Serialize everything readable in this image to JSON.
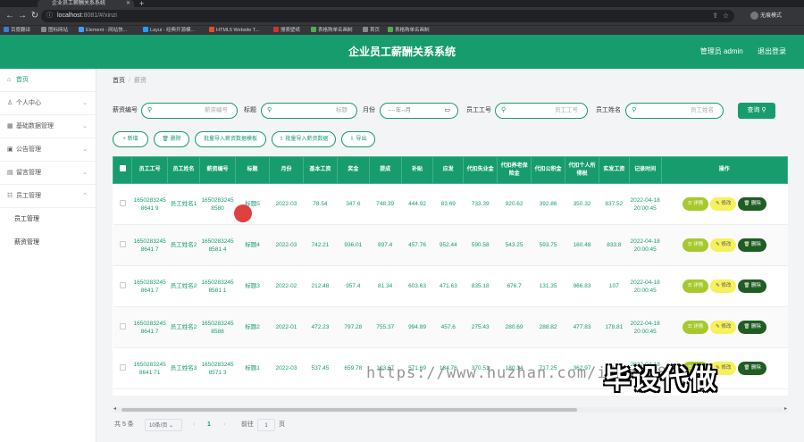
{
  "browser": {
    "tab_title": "企业员工薪酬关系系统",
    "url_host": "localhost",
    "url_rest": ":8081/#/xinzi",
    "profile_label": "无痕模式",
    "bookmarks": [
      "百度翻译",
      "图标网站",
      "Element - 网站快...",
      "Layui - 经典开源模...",
      "HTML5 Website T...",
      "搜索壁纸",
      "表格购单名画制",
      "首页",
      "表格购单名画制"
    ]
  },
  "header": {
    "title": "企业员工薪酬关系系统",
    "admin": "管理员 admin",
    "logout": "退出登录"
  },
  "sidebar": {
    "items": [
      {
        "label": "首页",
        "icon": "home-icon"
      },
      {
        "label": "个人中心",
        "icon": "user-icon"
      },
      {
        "label": "基础数据管理",
        "icon": "grid-icon"
      },
      {
        "label": "公告管理",
        "icon": "notice-icon"
      },
      {
        "label": "留言管理",
        "icon": "message-icon"
      },
      {
        "label": "员工管理",
        "icon": "staff-icon"
      }
    ],
    "subitems": [
      "员工管理",
      "薪资管理"
    ]
  },
  "breadcrumb": {
    "home": "首页",
    "separator": "/",
    "current": "薪资"
  },
  "search": {
    "label1": "薪资编号",
    "placeholder1": "薪资编号",
    "label2": "标题",
    "placeholder2": "标题",
    "label3": "月份",
    "placeholder3": "----年--月",
    "label4": "员工工号",
    "placeholder4": "员工工号",
    "label5": "员工姓名",
    "placeholder5": "员工姓名",
    "query": "查询"
  },
  "actions": {
    "add": "+ 新增",
    "delete": "删除",
    "batch_import": "批量导入薪资数据模板",
    "batch_import2": "批量导入薪资数据",
    "export": "导出"
  },
  "table": {
    "headers": [
      "员工工号",
      "员工姓名",
      "薪资编号",
      "标题",
      "月份",
      "基本工资",
      "奖金",
      "提成",
      "补贴",
      "应发",
      "代扣失业金",
      "代扣养老保险金",
      "代扣公积金",
      "代扣个人所得税",
      "实发工资",
      "记录时间",
      "操作"
    ],
    "rows": [
      [
        "16502832458641 9",
        "员工姓名1",
        "16502832458580",
        "标题5",
        "2022-03",
        "78.54",
        "347.6",
        "748.39",
        "444.92",
        "83.69",
        "733.39",
        "920.62",
        "392.86",
        "350.32",
        "837.52",
        "2022-04-18 20:00:45"
      ],
      [
        "16502832458641 7",
        "员工姓名2",
        "16502832458581 4",
        "标题4",
        "2022-03",
        "742.21",
        "936.01",
        "897.4",
        "457.76",
        "952.44",
        "590.58",
        "543.25",
        "593.75",
        "160.48",
        "833.8",
        "2022-04-18 20:00:45"
      ],
      [
        "16502832458641 7",
        "员工姓名2",
        "16502832458581 1",
        "标题3",
        "2022-02",
        "212.48",
        "957.4",
        "81.34",
        "603.63",
        "471.63",
        "835.18",
        "676.7",
        "131.35",
        "966.83",
        "107",
        "2022-04-18 20:00:45"
      ],
      [
        "16502832458641 7",
        "员工姓名2",
        "16502832458588",
        "标题2",
        "2022-01",
        "472.23",
        "797.28",
        "755.37",
        "994.89",
        "457.6",
        "275.43",
        "280.69",
        "288.82",
        "477.83",
        "178.81",
        "2022-04-18 20:00:45"
      ],
      [
        "16502832458641 71",
        "员工姓名3",
        "16502832458571 3",
        "标题1",
        "2022-03",
        "537.45",
        "659.78",
        "103.67",
        "571.69",
        "134.76",
        "370.51",
        "180.34",
        "717.25",
        "362.97",
        "511.81",
        "2022-04-18 20:00:45"
      ]
    ],
    "op_detail": "详情",
    "op_edit": "修改",
    "op_delete": "删除"
  },
  "pager": {
    "total": "共 5 条",
    "size": "10条/页",
    "prev": "‹",
    "page": "1",
    "next": "›",
    "goto": "前往",
    "goto_value": "1",
    "page_unit": "页"
  },
  "watermark": {
    "url": "https://www.huzhan.com/ishop3897",
    "brand": "毕设代做"
  }
}
